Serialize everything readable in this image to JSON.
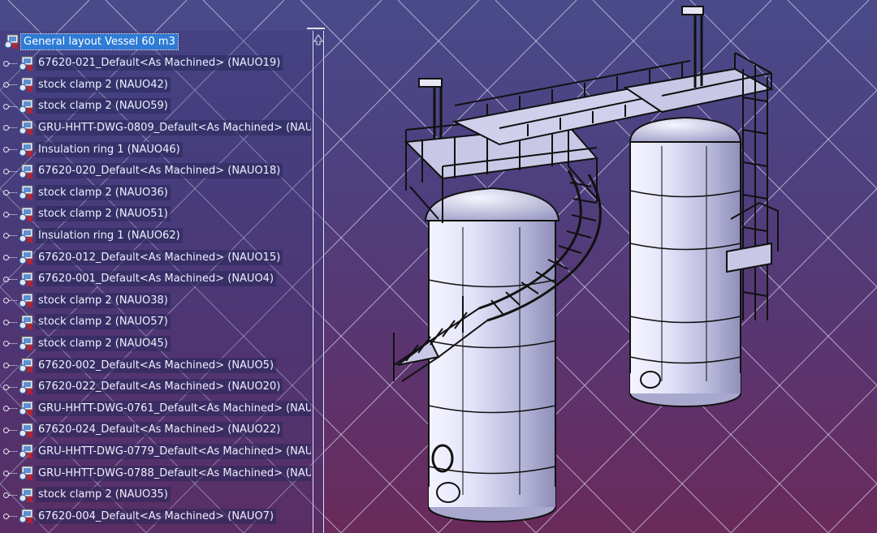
{
  "tree": {
    "root": {
      "label": "General layout Vessel 60 m3",
      "icon": "product-icon"
    },
    "items": [
      {
        "label": "67620-021_Default<As Machined> (NAUO19)",
        "icon": "part-icon"
      },
      {
        "label": "stock clamp 2 (NAUO42)",
        "icon": "part-icon"
      },
      {
        "label": "stock clamp 2 (NAUO59)",
        "icon": "part-icon"
      },
      {
        "label": "GRU-HHTT-DWG-0809_Default<As Machined> (NAU",
        "icon": "part-icon"
      },
      {
        "label": "Insulation ring 1 (NAUO46)",
        "icon": "part-icon"
      },
      {
        "label": "67620-020_Default<As Machined> (NAUO18)",
        "icon": "part-icon"
      },
      {
        "label": "stock clamp 2 (NAUO36)",
        "icon": "part-icon"
      },
      {
        "label": "stock clamp 2 (NAUO51)",
        "icon": "part-icon"
      },
      {
        "label": "Insulation ring 1 (NAUO62)",
        "icon": "part-icon"
      },
      {
        "label": "67620-012_Default<As Machined> (NAUO15)",
        "icon": "part-icon"
      },
      {
        "label": "67620-001_Default<As Machined> (NAUO4)",
        "icon": "part-icon"
      },
      {
        "label": "stock clamp 2 (NAUO38)",
        "icon": "part-icon"
      },
      {
        "label": "stock clamp 2 (NAUO57)",
        "icon": "part-icon"
      },
      {
        "label": "stock clamp 2 (NAUO45)",
        "icon": "part-icon"
      },
      {
        "label": "67620-002_Default<As Machined> (NAUO5)",
        "icon": "part-icon"
      },
      {
        "label": "67620-022_Default<As Machined> (NAUO20)",
        "icon": "part-icon"
      },
      {
        "label": "GRU-HHTT-DWG-0761_Default<As Machined> (NAU",
        "icon": "part-icon"
      },
      {
        "label": "67620-024_Default<As Machined> (NAUO22)",
        "icon": "part-icon"
      },
      {
        "label": "GRU-HHTT-DWG-0779_Default<As Machined> (NAU",
        "icon": "part-icon"
      },
      {
        "label": "GRU-HHTT-DWG-0788_Default<As Machined> (NAU",
        "icon": "part-icon"
      },
      {
        "label": "stock clamp 2 (NAUO35)",
        "icon": "part-icon"
      },
      {
        "label": "67620-004_Default<As Machined> (NAUO7)",
        "icon": "part-icon"
      }
    ]
  },
  "colors": {
    "grid": "#d8d8f0",
    "vessel": "#d8d8f4",
    "vessel_shade": "#a9a9cf",
    "outline": "#111111",
    "selection": "#2d7bd6"
  }
}
